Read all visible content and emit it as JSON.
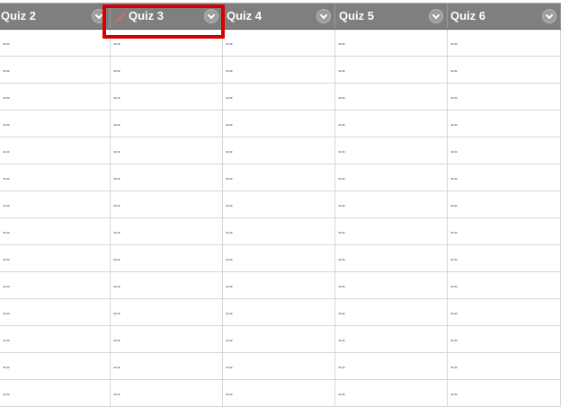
{
  "grid": {
    "columns": [
      {
        "label": "Quiz 2",
        "edit_icon": false
      },
      {
        "label": "Quiz 3",
        "edit_icon": true
      },
      {
        "label": "Quiz 4",
        "edit_icon": false
      },
      {
        "label": "Quiz 5",
        "edit_icon": false
      },
      {
        "label": "Quiz 6",
        "edit_icon": false
      }
    ],
    "rows": [
      [
        "--",
        "--",
        "--",
        "--",
        "--"
      ],
      [
        "--",
        "--",
        "--",
        "--",
        "--"
      ],
      [
        "--",
        "--",
        "--",
        "--",
        "--"
      ],
      [
        "--",
        "--",
        "--",
        "--",
        "--"
      ],
      [
        "--",
        "--",
        "--",
        "--",
        "--"
      ],
      [
        "--",
        "--",
        "--",
        "--",
        "--"
      ],
      [
        "--",
        "--",
        "--",
        "--",
        "--"
      ],
      [
        "--",
        "--",
        "--",
        "--",
        "--"
      ],
      [
        "--",
        "--",
        "--",
        "--",
        "--"
      ],
      [
        "--",
        "--",
        "--",
        "--",
        "--"
      ],
      [
        "--",
        "--",
        "--",
        "--",
        "--"
      ],
      [
        "--",
        "--",
        "--",
        "--",
        "--"
      ],
      [
        "--",
        "--",
        "--",
        "--",
        "--"
      ],
      [
        "--",
        "--",
        "--",
        "--",
        "--"
      ]
    ]
  },
  "colors": {
    "header_bg": "#7f7f7f",
    "header_text": "#ffffff",
    "cell_text": "#2a5a8a",
    "highlight_border": "#d70000",
    "edit_icon": "#e06868"
  },
  "icons": {
    "column_menu": "chevron-down-circle-icon",
    "edited_column": "pencil-icon"
  }
}
